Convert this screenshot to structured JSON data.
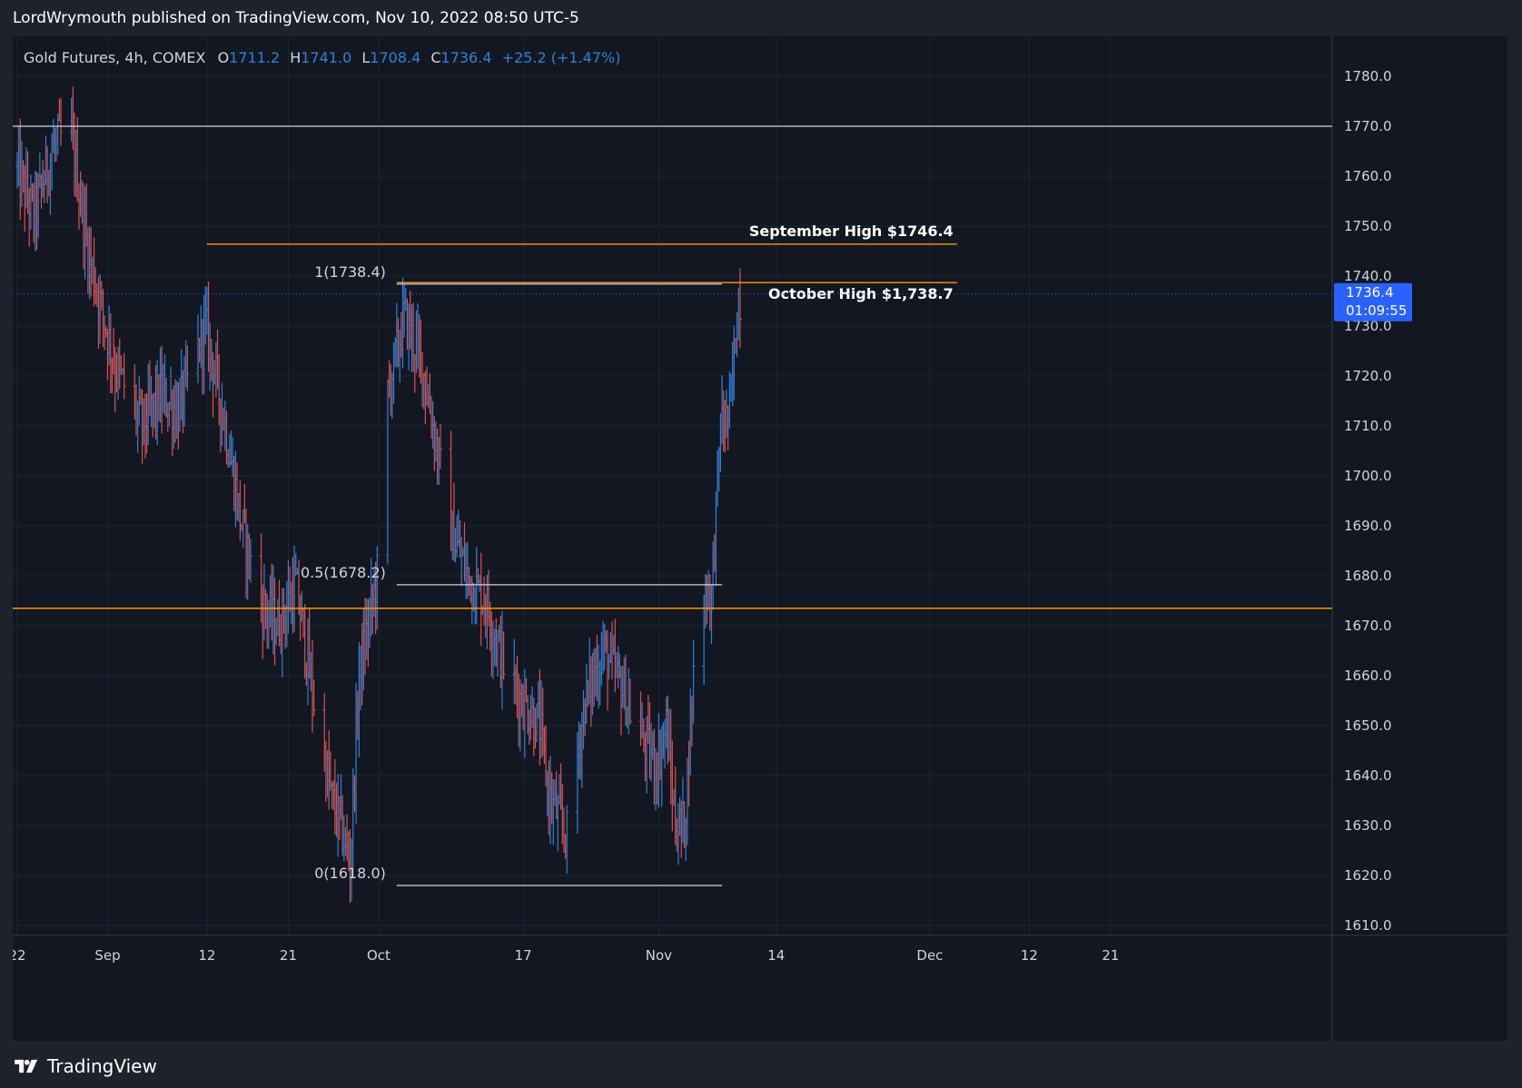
{
  "header": {
    "text": "LordWrymouth published on TradingView.com, Nov 10, 2022 08:50 UTC-5"
  },
  "legend": {
    "title": "Gold Futures, 4h, COMEX",
    "o_label": "O",
    "o_value": "1711.2",
    "h_label": "H",
    "h_value": "1741.0",
    "l_label": "L",
    "l_value": "1708.4",
    "c_label": "C",
    "c_value": "1736.4",
    "change": "+25.2 (+1.47%)"
  },
  "footer": {
    "brand": "TradingView"
  },
  "colors": {
    "background": "#131722",
    "grid": "#1f2433",
    "up": "#2e82d6",
    "down": "#d9534f",
    "orange": "#ff9800",
    "white_line": "#d1d4dc",
    "price_badge": "#2962ff"
  },
  "chart_data": {
    "type": "ohlc",
    "title": "Gold Futures, 4h, COMEX",
    "ylim": [
      1608,
      1788
    ],
    "y_ticks": [
      "1780.0",
      "1770.0",
      "1760.0",
      "1750.0",
      "1740.0",
      "1730.0",
      "1720.0",
      "1710.0",
      "1700.0",
      "1690.0",
      "1680.0",
      "1670.0",
      "1660.0",
      "1650.0",
      "1640.0",
      "1630.0",
      "1620.0",
      "1610.0"
    ],
    "x_ticks": [
      {
        "label": "22",
        "date": "2022-08-22"
      },
      {
        "label": "Sep",
        "date": "2022-09-01"
      },
      {
        "label": "12",
        "date": "2022-09-12"
      },
      {
        "label": "21",
        "date": "2022-09-21"
      },
      {
        "label": "Oct",
        "date": "2022-10-01"
      },
      {
        "label": "17",
        "date": "2022-10-17"
      },
      {
        "label": "Nov",
        "date": "2022-11-01"
      },
      {
        "label": "14",
        "date": "2022-11-14"
      },
      {
        "label": "Dec",
        "date": "2022-12-01"
      },
      {
        "label": "12",
        "date": "2022-12-12"
      },
      {
        "label": "21",
        "date": "2022-12-21"
      }
    ],
    "current_price": {
      "value": "1736.4",
      "countdown": "01:09:55"
    },
    "price_path": [
      [
        "2022-08-22",
        1762
      ],
      [
        "2022-08-24",
        1752
      ],
      [
        "2022-08-26",
        1765
      ],
      [
        "2022-08-28",
        1770
      ],
      [
        "2022-08-30",
        1745
      ],
      [
        "2022-09-02",
        1722
      ],
      [
        "2022-09-05",
        1710
      ],
      [
        "2022-09-07",
        1716
      ],
      [
        "2022-09-09",
        1713
      ],
      [
        "2022-09-12",
        1730
      ],
      [
        "2022-09-14",
        1712
      ],
      [
        "2022-09-16",
        1690
      ],
      [
        "2022-09-18",
        1675
      ],
      [
        "2022-09-20",
        1670
      ],
      [
        "2022-09-22",
        1678
      ],
      [
        "2022-09-24",
        1655
      ],
      [
        "2022-09-26",
        1635
      ],
      [
        "2022-09-27",
        1630
      ],
      [
        "2022-09-28",
        1622
      ],
      [
        "2022-09-29",
        1660
      ],
      [
        "2022-10-01",
        1680
      ],
      [
        "2022-10-02",
        1715
      ],
      [
        "2022-10-04",
        1732
      ],
      [
        "2022-10-06",
        1722
      ],
      [
        "2022-10-07",
        1712
      ],
      [
        "2022-10-09",
        1690
      ],
      [
        "2022-10-11",
        1680
      ],
      [
        "2022-10-13",
        1675
      ],
      [
        "2022-10-15",
        1662
      ],
      [
        "2022-10-17",
        1655
      ],
      [
        "2022-10-19",
        1650
      ],
      [
        "2022-10-20",
        1636
      ],
      [
        "2022-10-22",
        1628
      ],
      [
        "2022-10-24",
        1655
      ],
      [
        "2022-10-26",
        1665
      ],
      [
        "2022-10-28",
        1658
      ],
      [
        "2022-10-30",
        1648
      ],
      [
        "2022-11-01",
        1642
      ],
      [
        "2022-11-02",
        1650
      ],
      [
        "2022-11-03",
        1630
      ],
      [
        "2022-11-04",
        1630
      ],
      [
        "2022-11-05",
        1660
      ],
      [
        "2022-11-06",
        1678
      ],
      [
        "2022-11-07",
        1676
      ],
      [
        "2022-11-08",
        1710
      ],
      [
        "2022-11-09",
        1712
      ],
      [
        "2022-11-10",
        1736
      ]
    ],
    "horizontal_lines": [
      {
        "price": 1770.0,
        "color": "white"
      },
      {
        "price": 1673.5,
        "color": "orange"
      },
      {
        "price": 1746.4,
        "color": "orange",
        "label": "September High $1746.4"
      },
      {
        "price": 1738.7,
        "color": "orange",
        "label": "October High $1,738.7"
      }
    ],
    "fib": {
      "start_date": "2022-10-03",
      "end_date": "2022-11-08",
      "levels": [
        {
          "price": 1738.4,
          "label": "1(1738.4)"
        },
        {
          "price": 1678.2,
          "label": "0.5(1678.2)"
        },
        {
          "price": 1618.0,
          "label": "0(1618.0)"
        }
      ]
    }
  }
}
